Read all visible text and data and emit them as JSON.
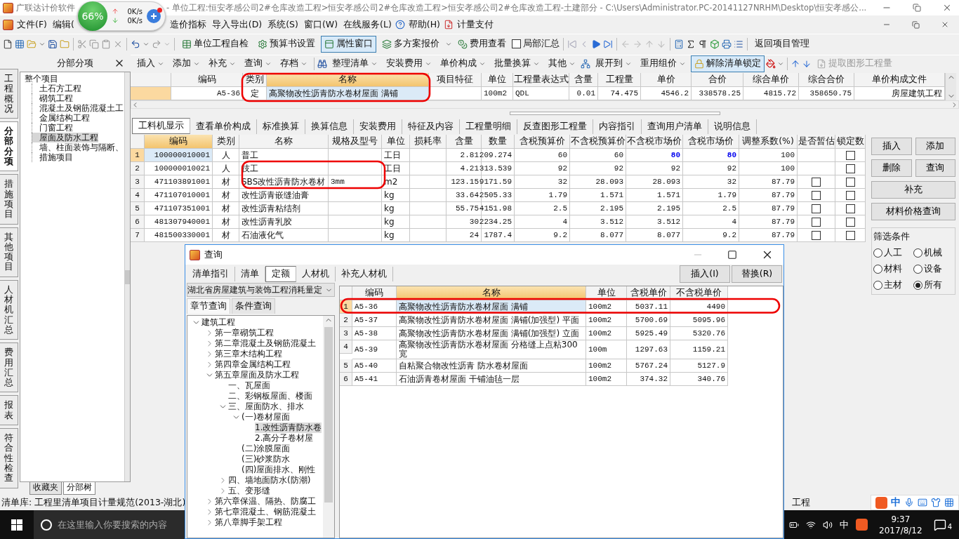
{
  "window": {
    "title_app": "广联达计价软件",
    "title_path": "- 单位工程:恒安孝感公司2#仓库改造工程>恒安孝感公司2#仓库改造工程>恒安孝感公司2#仓库改造工程-土建部分 - C:\\Users\\Administrator.PC-20141127NRHM\\Desktop\\恒安孝感公..."
  },
  "speed_widget": {
    "percent": "66%",
    "upload": "0K/s",
    "download": "0K/s"
  },
  "menu": {
    "items": [
      "文件(F)",
      "编辑(",
      "造价指标",
      "导入导出(D)",
      "系统(S)",
      "窗口(W)",
      "在线服务(L)",
      "帮助(H)",
      "计量支付"
    ]
  },
  "toolbar1": {
    "buttons": [
      {
        "label": "单位工程自检",
        "pressed": false
      },
      {
        "label": "预算书设置",
        "pressed": false
      },
      {
        "label": "属性窗口",
        "pressed": true
      },
      {
        "label": "多方案报价",
        "pressed": false
      },
      {
        "label": "费用查看",
        "pressed": false
      }
    ],
    "local_summary": {
      "label": "局部汇总",
      "checked": false
    },
    "return_label": "返回项目管理"
  },
  "sidebar_tabs": [
    {
      "label": "工程概况",
      "selected": false
    },
    {
      "label": "分部分项",
      "selected": true
    },
    {
      "label": "措施项目",
      "selected": false
    },
    {
      "label": "其他项目",
      "selected": false
    },
    {
      "label": "人材机汇总",
      "selected": false
    },
    {
      "label": "费用汇总",
      "selected": false
    },
    {
      "label": "报表",
      "selected": false
    },
    {
      "label": "符合性检查",
      "selected": false
    }
  ],
  "tree_panel": {
    "title": "分部分项",
    "root": {
      "label": "整个项目",
      "selected": false,
      "children": [
        {
          "label": "土石方工程",
          "selected": false
        },
        {
          "label": "砌筑工程",
          "selected": false
        },
        {
          "label": "混凝土及钢筋混凝土工",
          "selected": false
        },
        {
          "label": "金属结构工程",
          "selected": false
        },
        {
          "label": "门窗工程",
          "selected": false
        },
        {
          "label": "屋面及防水工程",
          "selected": true
        },
        {
          "label": "墙、柱面装饰与隔断、",
          "selected": false
        },
        {
          "label": "措施项目",
          "selected": false
        }
      ]
    },
    "bottom_tabs": [
      {
        "label": "收藏夹",
        "selected": false
      },
      {
        "label": "分部树",
        "selected": true
      }
    ]
  },
  "toolbar2": {
    "left": [
      "插入",
      "添加",
      "补充",
      "查询",
      "存档"
    ],
    "middle": [
      "整理清单",
      "安装费用",
      "单价构成",
      "批量换算",
      "其他",
      "展开到",
      "重用组价"
    ],
    "unlock": {
      "label": "解除清单锁定",
      "active": true
    },
    "extract": {
      "label": "提取图形工程量",
      "disabled": true
    }
  },
  "top_grid": {
    "columns": [
      "编码",
      "类别",
      "名称",
      "项目特征",
      "单位",
      "工程量表达式",
      "含量",
      "工程量",
      "单价",
      "合价",
      "综合单价",
      "综合合价",
      "单价构成文件"
    ],
    "rows": [
      {
        "selected": true,
        "cells": [
          "A5-36",
          "定",
          "高聚物改性沥青防水卷材屋面 满铺",
          null,
          "100m2",
          "QDL",
          "0.01",
          "74.475",
          "4546.2",
          "338578.25",
          "4815.72",
          "358650.75",
          "房屋建筑工程"
        ]
      }
    ]
  },
  "detail_tabs": [
    {
      "label": "工料机显示",
      "selected": true
    },
    {
      "label": "查看单价构成",
      "selected": false
    },
    {
      "label": "标准换算",
      "selected": false
    },
    {
      "label": "换算信息",
      "selected": false
    },
    {
      "label": "安装费用",
      "selected": false
    },
    {
      "label": "特征及内容",
      "selected": false
    },
    {
      "label": "工程量明细",
      "selected": false
    },
    {
      "label": "反查图形工程量",
      "selected": false
    },
    {
      "label": "内容指引",
      "selected": false
    },
    {
      "label": "查询用户清单",
      "selected": false
    },
    {
      "label": "说明信息",
      "selected": false
    }
  ],
  "detail_grid": {
    "columns": [
      "编码",
      "类别",
      "名称",
      "规格及型号",
      "单位",
      "损耗率",
      "含量",
      "数量",
      "含税预算价",
      "不含税预算价",
      "不含税市场价",
      "含税市场价",
      "调整系数(%)",
      "是否暂估",
      "锁定数"
    ],
    "rows": [
      {
        "no": "1",
        "selected": true,
        "market_price_changed": true,
        "locked": false,
        "cells": [
          "100000010001",
          "人",
          "普工",
          null,
          "工日",
          null,
          "2.81",
          "209.274",
          "60",
          "60",
          "80",
          "80",
          "100"
        ]
      },
      {
        "no": "2",
        "selected": false,
        "market_price_changed": false,
        "locked": false,
        "cells": [
          "100000010021",
          "人",
          "技工",
          null,
          "工日",
          null,
          "4.21",
          "313.539",
          "92",
          "92",
          "92",
          "92",
          "100"
        ]
      },
      {
        "no": "3",
        "selected": false,
        "market_price_changed": false,
        "provisional": false,
        "locked": false,
        "cells": [
          "471103891001",
          "材",
          "SBS改性沥青防水卷材",
          "3mm",
          "m2",
          null,
          "123.15",
          "9171.59",
          "32",
          "28.093",
          "28.093",
          "32",
          "87.79"
        ]
      },
      {
        "no": "4",
        "selected": false,
        "market_price_changed": false,
        "provisional": false,
        "locked": false,
        "cells": [
          "471107010001",
          "材",
          "改性沥青嵌缝油膏",
          null,
          "kg",
          null,
          "33.64",
          "2505.33",
          "1.79",
          "1.571",
          "1.571",
          "1.79",
          "87.79"
        ]
      },
      {
        "no": "5",
        "selected": false,
        "market_price_changed": false,
        "provisional": false,
        "locked": false,
        "cells": [
          "471107351001",
          "材",
          "改性沥青粘结剂",
          null,
          "kg",
          null,
          "55.75",
          "4151.98",
          "2.5",
          "2.195",
          "2.195",
          "2.5",
          "87.79"
        ]
      },
      {
        "no": "6",
        "selected": false,
        "market_price_changed": false,
        "provisional": false,
        "locked": false,
        "cells": [
          "481307940001",
          "材",
          "改性沥青乳胶",
          null,
          "kg",
          null,
          "30",
          "2234.25",
          "4",
          "3.512",
          "3.512",
          "4",
          "87.79"
        ]
      },
      {
        "no": "7",
        "selected": false,
        "market_price_changed": false,
        "provisional": false,
        "locked": false,
        "cells": [
          "481500330001",
          "材",
          "石油液化气",
          null,
          "kg",
          null,
          "24",
          "1787.4",
          "9.2",
          "8.077",
          "8.077",
          "9.2",
          "87.79"
        ]
      }
    ]
  },
  "right_panel": {
    "buttons": [
      "插入",
      "添加",
      "删除",
      "查询",
      "补充",
      "材料价格查询"
    ],
    "filter": {
      "title": "筛选条件",
      "options": [
        {
          "label": "人工",
          "selected": false
        },
        {
          "label": "机械",
          "selected": false
        },
        {
          "label": "材料",
          "selected": false
        },
        {
          "label": "设备",
          "selected": false
        },
        {
          "label": "主材",
          "selected": false
        },
        {
          "label": "所有",
          "selected": true
        }
      ]
    }
  },
  "dialog": {
    "title": "查询",
    "tabs": [
      {
        "label": "清单指引",
        "selected": false
      },
      {
        "label": "清单",
        "selected": false
      },
      {
        "label": "定额",
        "selected": true
      },
      {
        "label": "人材机",
        "selected": false
      },
      {
        "label": "补充人材机",
        "selected": false
      }
    ],
    "buttons": [
      "插入(I)",
      "替换(R)"
    ],
    "library": "湖北省房屋建筑与装饰工程消耗量定",
    "subtabs": [
      {
        "label": "章节查询",
        "selected": true
      },
      {
        "label": "条件查询",
        "selected": false
      }
    ],
    "tree": [
      {
        "label": "建筑工程",
        "expanded": true,
        "selected": false,
        "children": [
          {
            "label": "第一章砌筑工程",
            "expanded": false,
            "selected": false
          },
          {
            "label": "第二章混凝土及钢筋混凝土",
            "expanded": false,
            "selected": false
          },
          {
            "label": "第三章木结构工程",
            "expanded": false,
            "selected": false
          },
          {
            "label": "第四章金属结构工程",
            "expanded": false,
            "selected": false
          },
          {
            "label": "第五章屋面及防水工程",
            "expanded": true,
            "selected": false,
            "children": [
              {
                "label": "一、瓦屋面",
                "selected": false
              },
              {
                "label": "二、彩钢板屋面、楼面",
                "selected": false
              },
              {
                "label": "三、屋面防水、排水",
                "expanded": true,
                "selected": false,
                "children": [
                  {
                    "label": "(一)卷材屋面",
                    "expanded": true,
                    "selected": false,
                    "children": [
                      {
                        "label": "1.改性沥青防水卷",
                        "selected": true
                      },
                      {
                        "label": "2.高分子卷材屋",
                        "selected": false
                      }
                    ]
                  },
                  {
                    "label": "(二)涂膜屋面",
                    "selected": false
                  },
                  {
                    "label": "(三)砂浆防水",
                    "selected": false
                  },
                  {
                    "label": "(四)屋面排水、刚性",
                    "selected": false
                  }
                ]
              },
              {
                "label": "四、墙地面防水(防潮)",
                "expanded": false,
                "selected": false
              },
              {
                "label": "五、变形缝",
                "expanded": false,
                "selected": false
              }
            ]
          },
          {
            "label": "第六章保温、隔热、防腐工",
            "expanded": false,
            "selected": false
          },
          {
            "label": "第七章混凝土、钢筋混凝土",
            "expanded": false,
            "selected": false
          },
          {
            "label": "第八章脚手架工程",
            "expanded": false,
            "selected": false
          }
        ]
      }
    ],
    "grid": {
      "columns": [
        "编码",
        "名称",
        "单位",
        "含税单价",
        "不含税单价"
      ],
      "rows": [
        {
          "no": "1",
          "selected": true,
          "cells": [
            "A5-36",
            "高聚物改性沥青防水卷材屋面 满铺",
            "100m2",
            "5037.11",
            "4490"
          ]
        },
        {
          "no": "2",
          "selected": false,
          "cells": [
            "A5-37",
            "高聚物改性沥青防水卷材屋面 满铺(加强型) 平面",
            "100m2",
            "5700.69",
            "5095.96"
          ]
        },
        {
          "no": "3",
          "selected": false,
          "cells": [
            "A5-38",
            "高聚物改性沥青防水卷材屋面 满铺(加强型) 立面",
            "100m2",
            "5925.49",
            "5320.76"
          ]
        },
        {
          "no": "4",
          "selected": false,
          "cells": [
            "A5-39",
            "高聚物改性沥青防水卷材屋面 分格缝上点粘300宽",
            "100m",
            "1297.63",
            "1159.21"
          ]
        },
        {
          "no": "5",
          "selected": false,
          "cells": [
            "A5-40",
            "自粘聚合物改性沥青 防水卷材屋面",
            "100m2",
            "5767.24",
            "5127.9"
          ]
        },
        {
          "no": "6",
          "selected": false,
          "cells": [
            "A5-41",
            "石油沥青卷材屋面 干铺油毡一层",
            "100m2",
            "374.32",
            "340.76"
          ]
        }
      ]
    }
  },
  "status_bar": {
    "text": "清单库: 工程里清单项目计量规范(2013-湖北)",
    "right_text": "工程"
  },
  "ime_bar": {
    "mode": "中"
  },
  "taskbar": {
    "search_placeholder": "在这里输入你要搜索的内容",
    "ime": "中",
    "time": "9:37",
    "date": "2017/8/12",
    "notifications": "4"
  }
}
